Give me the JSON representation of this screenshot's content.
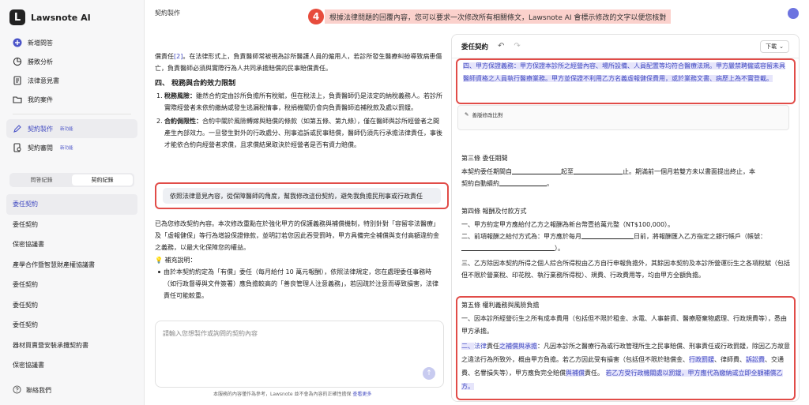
{
  "app": {
    "name": "Lawsnote AI",
    "page_title": "契約製作"
  },
  "banner": {
    "step": "4",
    "text": "根據法律問題的回覆內容，您可以要求一次修改所有相關條文，Lawsnote AI 會標示修改的文字以便您核對"
  },
  "sidebar": {
    "items": [
      {
        "label": "新增問答",
        "icon": "plus-circle-icon"
      },
      {
        "label": "勝敗分析",
        "icon": "pie-chart-icon"
      },
      {
        "label": "法律意見書",
        "icon": "document-icon"
      },
      {
        "label": "我的案件",
        "icon": "folder-icon"
      }
    ],
    "items2": [
      {
        "label": "契約製作",
        "badge": "新功能",
        "icon": "pen-icon"
      },
      {
        "label": "契約審閱",
        "badge": "新功能",
        "icon": "review-icon"
      }
    ],
    "tabs": [
      "問答紀錄",
      "契約紀錄"
    ],
    "contracts": [
      "委任契約",
      "委任契約",
      "保密協議書",
      "產學合作暨智慧財產權協議書",
      "委任契約",
      "委任契約",
      "委任契約",
      "器材買賣暨安裝承攬契約書",
      "保密協議書"
    ],
    "contact": "聯絡我們"
  },
  "chat": {
    "p1_pre": "償責任",
    "p1_ref": "[2]",
    "p1_post": "。在法律形式上，負責醫師常被視為診所醫護人員的僱用人，若診所發生醫療糾紛導致病患傷亡，負責醫師必須與實際行為人共同承擔賠償的民事賠償責任。",
    "heading": "四、 稅務與合約效力限制",
    "list": [
      {
        "num": "1.",
        "title": "稅務風險：",
        "text": "雖然合約定由診所負擔所有稅賦，但在稅法上，負責醫師仍是法定的納稅義務人。若診所實際經營者未依約繳納或發生逃漏稅情事，稅捐機關仍會向負責醫師追補稅款及處以罰鍰。"
      },
      {
        "num": "2.",
        "title": "合約侷限性：",
        "text": "合約中關於風險轉嫁與賠償的條款（如第五條、第九條），僅在醫師與診所經營者之間產生內部效力。一旦發生對外的行政處分、刑事追訴或民事賠償，醫師仍須先行承擔法律責任，事後才能依合約向經營者求償，且求償結果取決於經營者是否有資力賠償。"
      }
    ],
    "user_message": "依照法律意見內容，從保障醫師的角度，幫我修改這份契約，避免我負擔民刑事或行政責任",
    "reply": "已為您修改契約內容。本次修改重點在於強化甲方的保護義務與補償機制，特別針對「容留非法醫療」及「虛報健保」等行為增設保證條款，並明訂若您因此吞受罰時，甲方具備完全補償與支付高額違約金之義務，以最大化保障您的權益。",
    "note_label": "補充說明：",
    "note": "由於本契約約定為「有償」委任（每月給付 10 萬元報酬），依照法律規定，您在處理委任事務時（如行政督導與文件簽署）應負擔較高的「善良管理人注意義務」，若因疏於注意而導致損害，法律責任可能較重。",
    "input_placeholder": "請輸入您想製作或詢問的契約內容",
    "disclaimer": "本服務的內容僅作為參考，Lawsnote 並不會為內容的正確性擔保",
    "disclaimer_link": "查看更多"
  },
  "doc": {
    "title": "委任契約",
    "download": "下載",
    "clause4_hl": "四、甲方保證義務：甲方保證本診所之經營內容、場所設備、人員配置等均符合醫療法規。甲方嚴禁聘僱或容留未具醫師資格之人員執行醫療業務。甲方並保證不利用乙方名義虛報健保費用，或於業務文書、病歷上為不實登載。",
    "edit_label": "善版修改比對",
    "art3_title": "第三條  委任期間",
    "art3_l1a": "本契約委任期間自",
    "art3_l1b": "起至",
    "art3_l1c": "止。期滿前一個月若雙方未以書面提出終止，本",
    "art3_l2": "契約自動續約",
    "art4_title": "第四條  報酬及付款方式",
    "art4_l1": "一、甲方約定甲方應給付乙方之報酬為新台幣壹拾萬元整（NT$100,000）。",
    "art4_l2a": "二、前項報酬之給付方式為：甲方應於每月",
    "art4_l2b": "日前，將報酬匯入乙方指定之銀行帳戶（帳號：",
    "art4_l3": "三、乙方除因本契約所得之個人綜合所得稅由乙方自行申報負擔外，其餘因本契約及本診所營運衍生之各項稅賦（包括但不限於營業稅、印花稅、執行業務所得稅）、規費、行政費用等，均由甲方全額負擔。",
    "art5_title": "第五條  權利義務與風險負擔",
    "art5_l1": "一、因本診所經營衍生之所有成本費用（包括但不限於租金、水電、人事薪資、醫療廢棄物處理、行政規費等），悉由甲方承擔。",
    "art5_l2_a": "二、",
    "art5_l2_b": "法律",
    "art5_l2_c": "責任",
    "art5_l2_d": "之補償與承擔",
    "art5_l2_e": "：凡因本診所之醫療行為或行政管理所生之民事賠償、刑事責任或行政罰鍰，除因乙方故意之違法行為所致外，概由甲方負擔。若乙方因此受有損害（包括但不限於賠償金、",
    "art5_l2_f": "行政罰鍰",
    "art5_l2_g": "、律師費、",
    "art5_l2_h": "訴訟費",
    "art5_l2_i": "、交通費、名譽損失等），甲方應負完全賠償",
    "art5_l2_j": "與補償",
    "art5_l2_k": "責任。",
    "art5_l2_l": "若乙方受行政機關處以罰鍰，甲方應代為繳納或立即全額補償乙方。"
  }
}
